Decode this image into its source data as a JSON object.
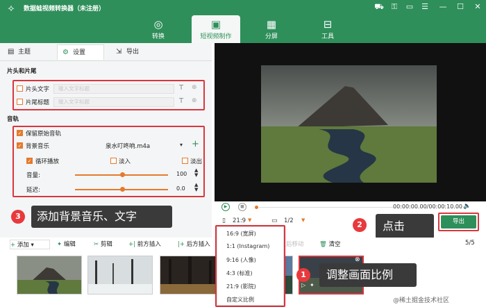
{
  "app": {
    "title": "数据蛙视频转换器（未注册）"
  },
  "main_tabs": [
    {
      "label": "转换",
      "icon": "convert-icon"
    },
    {
      "label": "短视频制作",
      "icon": "short-video-icon"
    },
    {
      "label": "分屏",
      "icon": "split-screen-icon"
    },
    {
      "label": "工具",
      "icon": "toolbox-icon"
    }
  ],
  "sub_tabs": [
    {
      "label": "主题"
    },
    {
      "label": "设置"
    },
    {
      "label": "导出"
    }
  ],
  "settings": {
    "section_intro": "片头和片尾",
    "intro_label": "片头文字",
    "intro_placeholder": "输入文字标题",
    "outro_label": "片尾标题",
    "outro_placeholder": "输入文字标题",
    "section_audio": "音轨",
    "keep_original": "保留原始音轨",
    "bg_music": "背景音乐",
    "music_file": "泉水叮咚响.m4a",
    "loop": "循环播放",
    "fade_in": "淡入",
    "fade_out": "淡出",
    "volume_label": "音量:",
    "volume_value": "100",
    "delay_label": "延迟:",
    "delay_value": "0.0"
  },
  "player": {
    "time": "00:00:00.00/00:00:10.00",
    "ratio": "21:9",
    "page": "1/2",
    "export_label": "导出"
  },
  "toolbar": {
    "add": "添加",
    "edit": "编辑",
    "cut": "剪辑",
    "insert_before": "前方插入",
    "insert_after": "后方插入",
    "move_back": "后移动",
    "clear": "清空",
    "count": "5/5"
  },
  "ratio_options": [
    "16:9 (宽屏)",
    "1:1 (Instagram)",
    "9:16 (人像)",
    "4:3 (标准)",
    "21:9 (影院)",
    "自定义比例"
  ],
  "annotations": {
    "a1_num": "1",
    "a1_text": "调整画面比例",
    "a2_num": "2",
    "a2_text": "点击",
    "a3_num": "3",
    "a3_text": "添加背景音乐、文字"
  },
  "watermark": "@稀土掘金技术社区",
  "colors": {
    "brand": "#2e8f5a",
    "accent": "#e47a2c",
    "highlight": "#d9363e"
  }
}
